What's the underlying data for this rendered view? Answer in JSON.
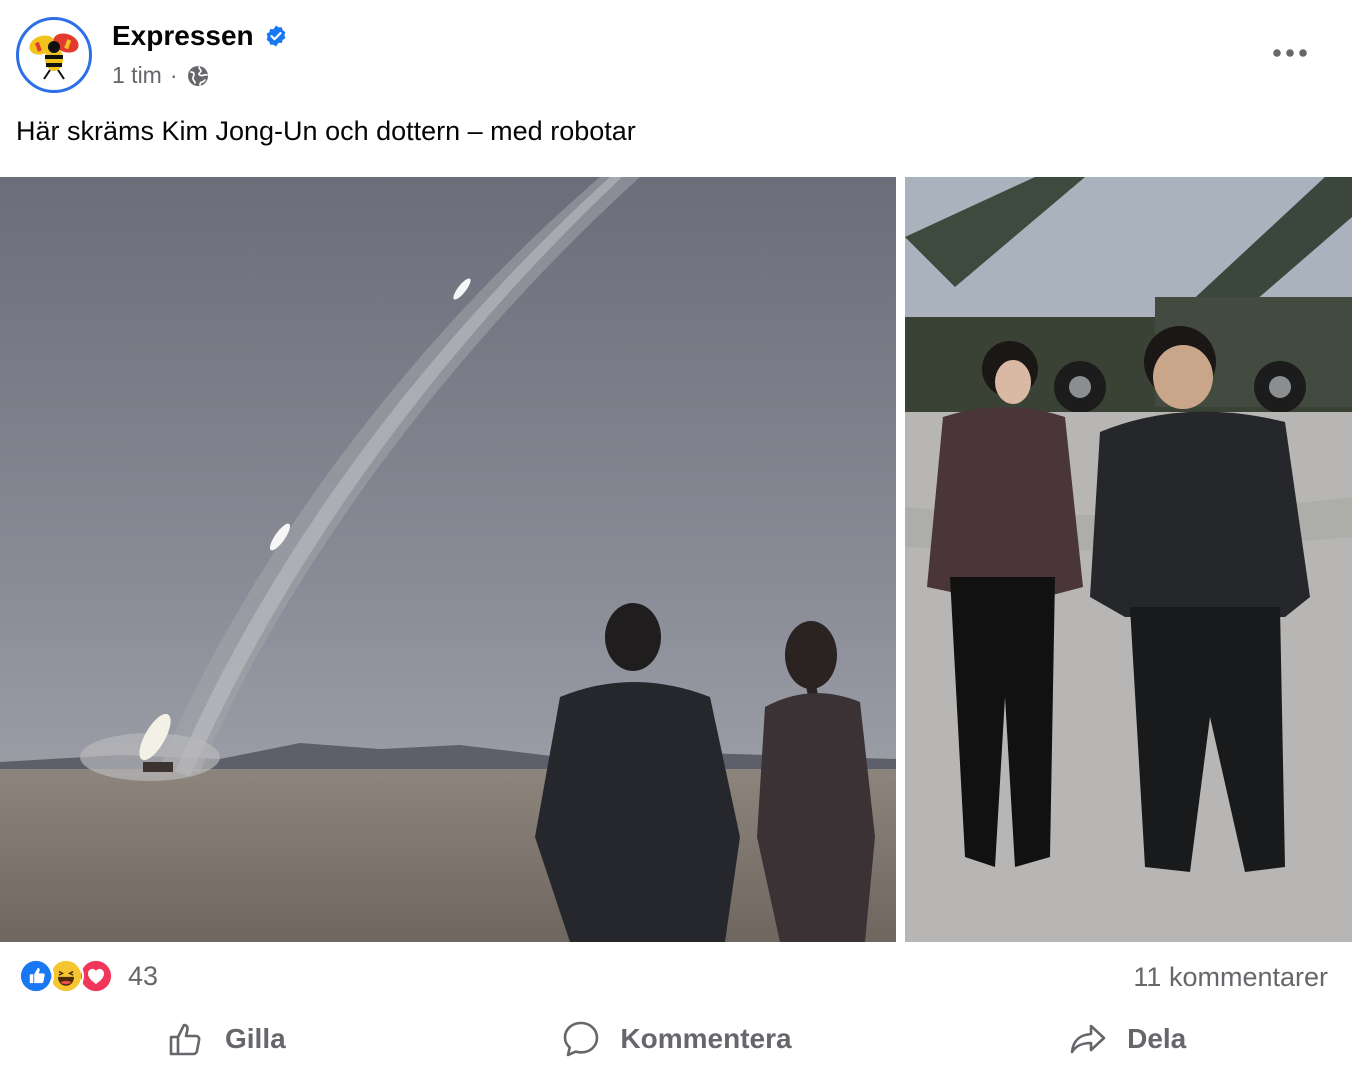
{
  "post": {
    "page_name": "Expressen",
    "time": "1 tim",
    "separator": "·",
    "text": "Här skräms Kim Jong-Un och dottern – med robotar"
  },
  "icons": {
    "avatar": "expressen-wasp-logo",
    "verified": "verified-badge-icon",
    "audience": "globe-icon",
    "more": "more-options-icon"
  },
  "stats": {
    "reaction_count": "43",
    "comments": "11 kommentarer"
  },
  "actions": {
    "like": "Gilla",
    "comment": "Kommentera",
    "share": "Dela"
  },
  "colors": {
    "accent": "#1877f2",
    "secondary_text": "#65676b"
  }
}
